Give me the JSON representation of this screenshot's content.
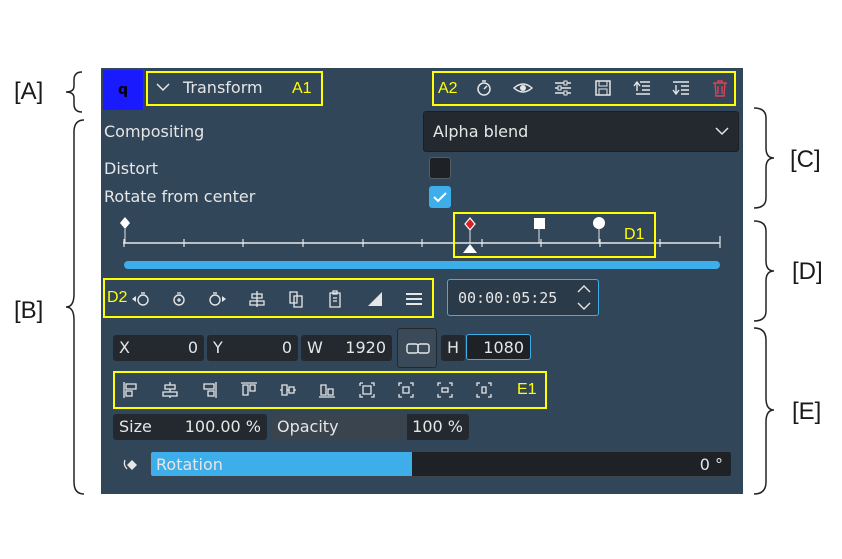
{
  "annotations": {
    "A": "[A]",
    "B": "[B]",
    "C": "[C]",
    "D": "[D]",
    "E": "[E]",
    "A1": "A1",
    "A2": "A2",
    "D1": "D1",
    "D2": "D2",
    "E1": "E1"
  },
  "header": {
    "badge": "q",
    "title": "Transform",
    "icons": [
      "keyframe-timer-icon",
      "eye-icon",
      "adjust-sliders-icon",
      "save-icon",
      "move-up-icon",
      "move-down-icon",
      "delete-icon"
    ]
  },
  "properties": {
    "compositing_label": "Compositing",
    "compositing_value": "Alpha blend",
    "distort_label": "Distort",
    "distort_checked": false,
    "rotate_center_label": "Rotate from center",
    "rotate_center_checked": true
  },
  "keyframes": {
    "toolbar_icons": [
      "previous-keyframe-icon",
      "add-keyframe-icon",
      "next-keyframe-icon",
      "align-center-icon",
      "copy-icon",
      "paste-icon",
      "interpolation-icon",
      "menu-icon"
    ],
    "timecode": "00:00:05:25",
    "markers": [
      "keyframe-start",
      "keyframe-selected",
      "keyframe-square",
      "keyframe-round"
    ]
  },
  "geometry": {
    "x_label": "X",
    "x_value": "0",
    "y_label": "Y",
    "y_value": "0",
    "w_label": "W",
    "w_value": "1920",
    "h_label": "H",
    "h_value": "1080",
    "align_icons": [
      "align-left-icon",
      "align-hcenter-icon",
      "align-right-icon",
      "align-top-icon",
      "align-vcenter-icon",
      "align-bottom-icon",
      "fit-icon",
      "center-icon",
      "center-h-icon",
      "center-v-icon"
    ],
    "size_label": "Size",
    "size_value": "100.00 %",
    "opacity_label": "Opacity",
    "opacity_value": "100 %"
  },
  "rotation": {
    "label": "Rotation",
    "value": "0 °",
    "fill_fraction": 0.45
  },
  "colors": {
    "panel_bg": "#32465a",
    "accent": "#3daee9",
    "annotation": "#ffff00",
    "delete": "#da4453",
    "badge": "#1a1aff"
  }
}
